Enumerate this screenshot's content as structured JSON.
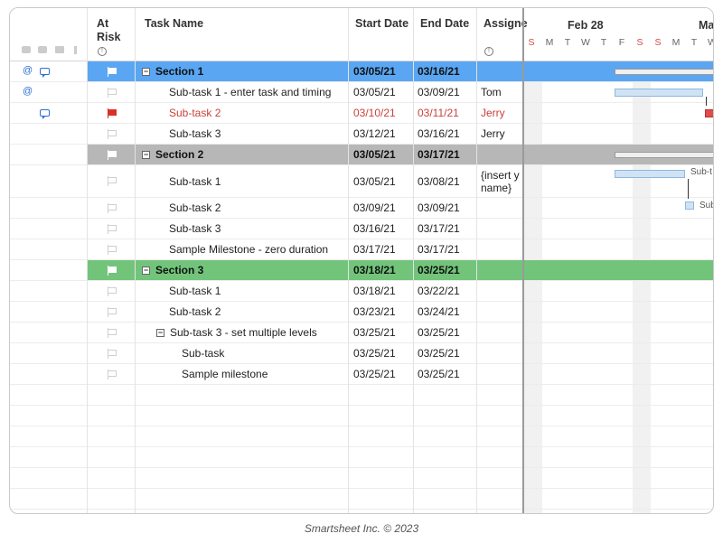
{
  "headers": {
    "at_risk_line1": "At",
    "at_risk_line2": "Risk",
    "task_name": "Task Name",
    "start_date": "Start Date",
    "end_date": "End Date",
    "assigned": "Assigne"
  },
  "gantt": {
    "week1": "Feb 28",
    "week2": "Ma",
    "days": [
      "S",
      "M",
      "T",
      "W",
      "T",
      "F",
      "S",
      "S",
      "M",
      "T",
      "W"
    ],
    "labels": [
      "Sub-t",
      "Sub"
    ]
  },
  "rows": [
    {
      "task": "Section 1",
      "start": "03/05/21",
      "end": "03/16/21",
      "assigned": ""
    },
    {
      "task": "Sub-task 1 - enter task and timing",
      "start": "03/05/21",
      "end": "03/09/21",
      "assigned": "Tom"
    },
    {
      "task": "Sub-task 2",
      "start": "03/10/21",
      "end": "03/11/21",
      "assigned": "Jerry"
    },
    {
      "task": "Sub-task 3",
      "start": "03/12/21",
      "end": "03/16/21",
      "assigned": "Jerry"
    },
    {
      "task": "Section 2",
      "start": "03/05/21",
      "end": "03/17/21",
      "assigned": ""
    },
    {
      "task": "Sub-task 1",
      "start": "03/05/21",
      "end": "03/08/21",
      "assigned": "{insert y",
      "assigned2": "name}"
    },
    {
      "task": "Sub-task 2",
      "start": "03/09/21",
      "end": "03/09/21",
      "assigned": ""
    },
    {
      "task": "Sub-task 3",
      "start": "03/16/21",
      "end": "03/17/21",
      "assigned": ""
    },
    {
      "task": "Sample Milestone - zero duration",
      "start": "03/17/21",
      "end": "03/17/21",
      "assigned": ""
    },
    {
      "task": "Section 3",
      "start": "03/18/21",
      "end": "03/25/21",
      "assigned": ""
    },
    {
      "task": "Sub-task 1",
      "start": "03/18/21",
      "end": "03/22/21",
      "assigned": ""
    },
    {
      "task": "Sub-task 2",
      "start": "03/23/21",
      "end": "03/24/21",
      "assigned": ""
    },
    {
      "task": "Sub-task 3 - set multiple levels",
      "start": "03/25/21",
      "end": "03/25/21",
      "assigned": ""
    },
    {
      "task": "Sub-task",
      "start": "03/25/21",
      "end": "03/25/21",
      "assigned": ""
    },
    {
      "task": "Sample milestone",
      "start": "03/25/21",
      "end": "03/25/21",
      "assigned": ""
    }
  ],
  "colors": {
    "section1": "#5aa6f2",
    "section2": "#b7b7b7",
    "section3": "#72c47a",
    "at_risk": "#c9413b"
  },
  "footer": "Smartsheet Inc. © 2023"
}
